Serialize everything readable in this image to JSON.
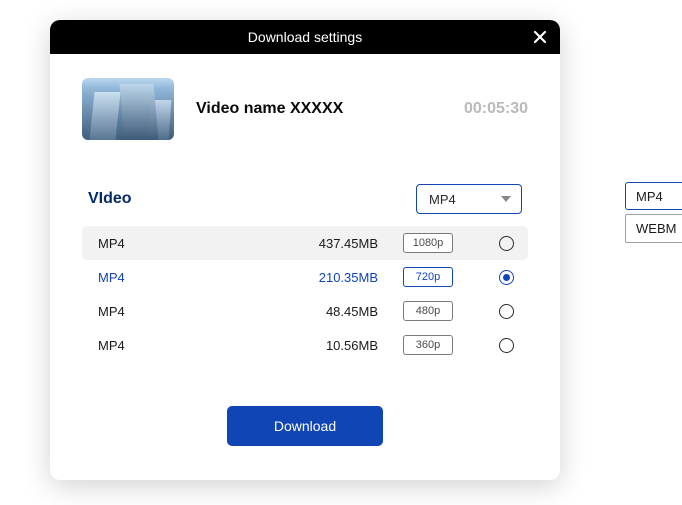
{
  "dialog": {
    "title": "Download settings"
  },
  "video": {
    "name": "Video name XXXXX",
    "duration": "00:05:30"
  },
  "section": {
    "label": "VIdeo"
  },
  "format_select": {
    "value": "MP4"
  },
  "options": [
    {
      "format": "MP4",
      "size": "437.45MB",
      "resolution": "1080p",
      "selected": false,
      "hover": true
    },
    {
      "format": "MP4",
      "size": "210.35MB",
      "resolution": "720p",
      "selected": true,
      "hover": false
    },
    {
      "format": "MP4",
      "size": "48.45MB",
      "resolution": "480p",
      "selected": false,
      "hover": false
    },
    {
      "format": "MP4",
      "size": "10.56MB",
      "resolution": "360p",
      "selected": false,
      "hover": false
    }
  ],
  "download_button": "Download",
  "external_dropdown": {
    "value": "MP4",
    "items": [
      "WEBM"
    ]
  }
}
